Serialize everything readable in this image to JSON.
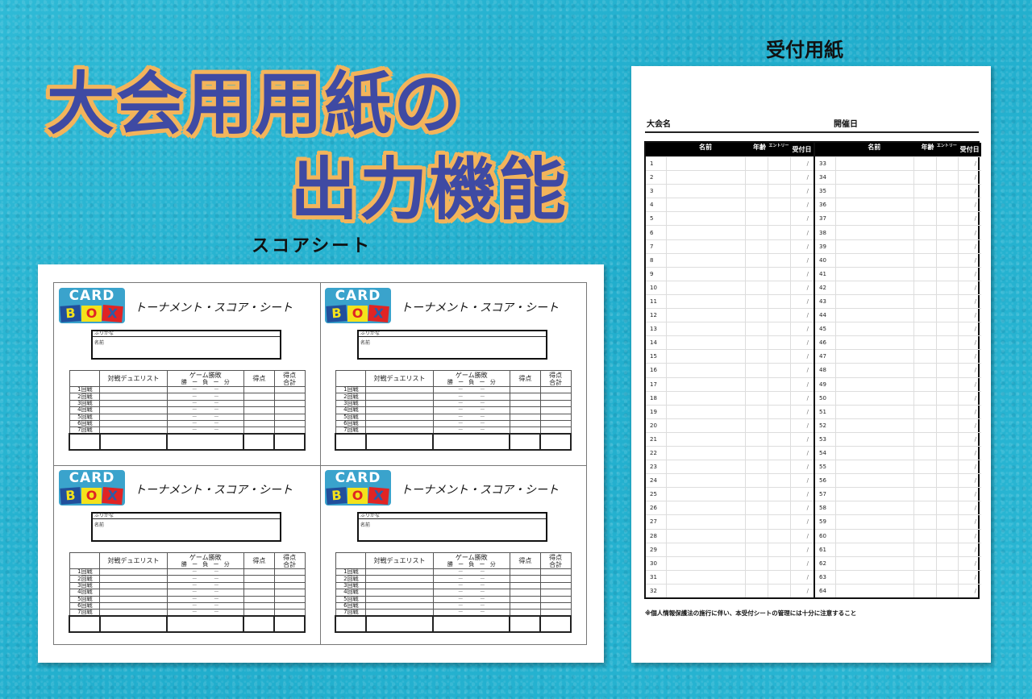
{
  "headline": {
    "line1": "大会用用紙の",
    "line2": "出力機能",
    "text_color": "#3f4aa3",
    "outline_color": "#f3b45b"
  },
  "background_color": "#27b4d2",
  "score_sheet_section": {
    "label": "スコアシート",
    "sheets": [
      {
        "logo": {
          "top": "CARD",
          "letters": [
            "B",
            "O",
            "X"
          ]
        },
        "title": "トーナメント・スコア・シート",
        "furigana_label": "ふりがな",
        "name_label": "名前",
        "table": {
          "headers": {
            "opponent": "対戦デュエリスト",
            "game_result": "ゲーム勝敗",
            "sub": [
              "勝",
              "ー",
              "負",
              "ー",
              "分"
            ],
            "points": "得点",
            "total": "得点合計",
            "total_line1": "得点",
            "total_line2": "合計"
          },
          "rounds": [
            "1回戦",
            "2回戦",
            "3回戦",
            "4回戦",
            "5回戦",
            "6回戦",
            "7回戦"
          ],
          "dash_cell": "－ －"
        }
      },
      {
        "logo": {
          "top": "CARD",
          "letters": [
            "B",
            "O",
            "X"
          ]
        },
        "title": "トーナメント・スコア・シート",
        "furigana_label": "ふりがな",
        "name_label": "名前",
        "table": {
          "headers": {
            "opponent": "対戦デュエリスト",
            "game_result": "ゲーム勝敗",
            "sub": [
              "勝",
              "ー",
              "負",
              "ー",
              "分"
            ],
            "points": "得点",
            "total_line1": "得点",
            "total_line2": "合計"
          },
          "rounds": [
            "1回戦",
            "2回戦",
            "3回戦",
            "4回戦",
            "5回戦",
            "6回戦",
            "7回戦"
          ],
          "dash_cell": "－ －"
        }
      },
      {
        "logo": {
          "top": "CARD",
          "letters": [
            "B",
            "O",
            "X"
          ]
        },
        "title": "トーナメント・スコア・シート",
        "furigana_label": "ふりがな",
        "name_label": "名前",
        "table": {
          "headers": {
            "opponent": "対戦デュエリスト",
            "game_result": "ゲーム勝敗",
            "sub": [
              "勝",
              "ー",
              "負",
              "ー",
              "分"
            ],
            "points": "得点",
            "total_line1": "得点",
            "total_line2": "合計"
          },
          "rounds": [
            "1回戦",
            "2回戦",
            "3回戦",
            "4回戦",
            "5回戦",
            "6回戦",
            "7回戦"
          ],
          "dash_cell": "－ －"
        }
      },
      {
        "logo": {
          "top": "CARD",
          "letters": [
            "B",
            "O",
            "X"
          ]
        },
        "title": "トーナメント・スコア・シート",
        "furigana_label": "ふりがな",
        "name_label": "名前",
        "table": {
          "headers": {
            "opponent": "対戦デュエリスト",
            "game_result": "ゲーム勝敗",
            "sub": [
              "勝",
              "ー",
              "負",
              "ー",
              "分"
            ],
            "points": "得点",
            "total_line1": "得点",
            "total_line2": "合計"
          },
          "rounds": [
            "1回戦",
            "2回戦",
            "3回戦",
            "4回戦",
            "5回戦",
            "6回戦",
            "7回戦"
          ],
          "dash_cell": "－ －"
        }
      }
    ]
  },
  "reception_section": {
    "label": "受付用紙",
    "tournament_name_label": "大会名",
    "date_label": "開催日",
    "columns": [
      "名前",
      "年齢",
      "エントリー",
      "受付日"
    ],
    "date_placeholder": "/",
    "left_numbers": [
      1,
      2,
      3,
      4,
      5,
      6,
      7,
      8,
      9,
      10,
      11,
      12,
      13,
      14,
      15,
      16,
      17,
      18,
      19,
      20,
      21,
      22,
      23,
      24,
      25,
      26,
      27,
      28,
      29,
      30,
      31,
      32
    ],
    "right_numbers": [
      33,
      34,
      35,
      36,
      37,
      38,
      39,
      40,
      41,
      42,
      43,
      44,
      45,
      46,
      47,
      48,
      49,
      50,
      51,
      52,
      53,
      54,
      55,
      56,
      57,
      58,
      59,
      60,
      61,
      62,
      63,
      64
    ],
    "note": "※個人情報保護法の施行に伴い、本受付シートの管理には十分に注意すること"
  }
}
